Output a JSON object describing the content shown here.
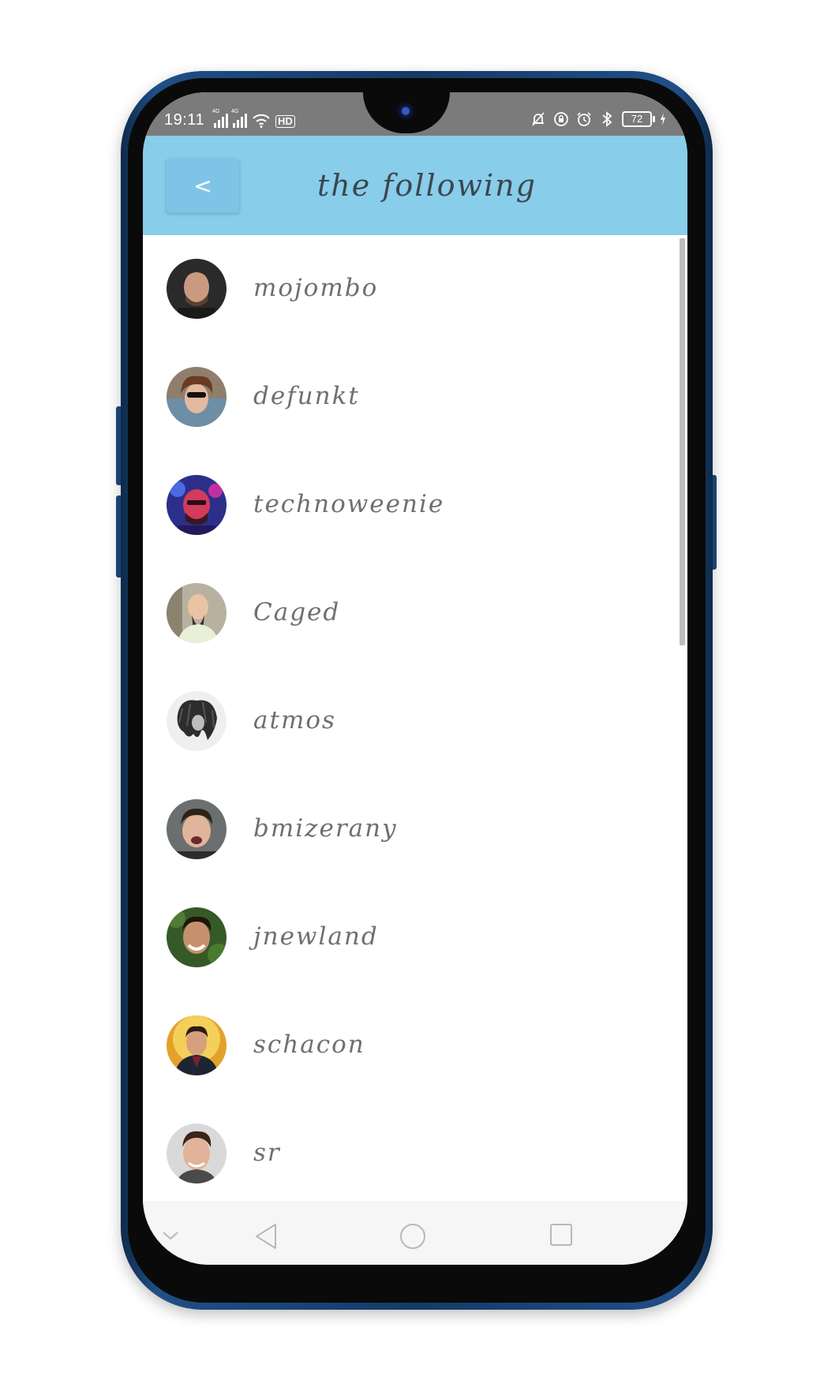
{
  "status_bar": {
    "time": "19:11",
    "network_1": "4G",
    "network_2": "4G",
    "hd_label": "HD",
    "battery": "72"
  },
  "header": {
    "back_label": "<",
    "title": "the following",
    "background_color": "#88cdea"
  },
  "following": [
    {
      "username": "mojombo",
      "avatar_icon": "user-avatar"
    },
    {
      "username": "defunkt",
      "avatar_icon": "user-avatar"
    },
    {
      "username": "technoweenie",
      "avatar_icon": "user-avatar"
    },
    {
      "username": "Caged",
      "avatar_icon": "user-avatar"
    },
    {
      "username": "atmos",
      "avatar_icon": "user-avatar"
    },
    {
      "username": "bmizerany",
      "avatar_icon": "user-avatar"
    },
    {
      "username": "jnewland",
      "avatar_icon": "user-avatar"
    },
    {
      "username": "schacon",
      "avatar_icon": "user-avatar"
    },
    {
      "username": "sr",
      "avatar_icon": "user-avatar"
    }
  ],
  "nav_bar": {
    "icons": [
      "chevron-down-icon",
      "back-triangle-icon",
      "home-circle-icon",
      "recent-square-icon"
    ]
  }
}
